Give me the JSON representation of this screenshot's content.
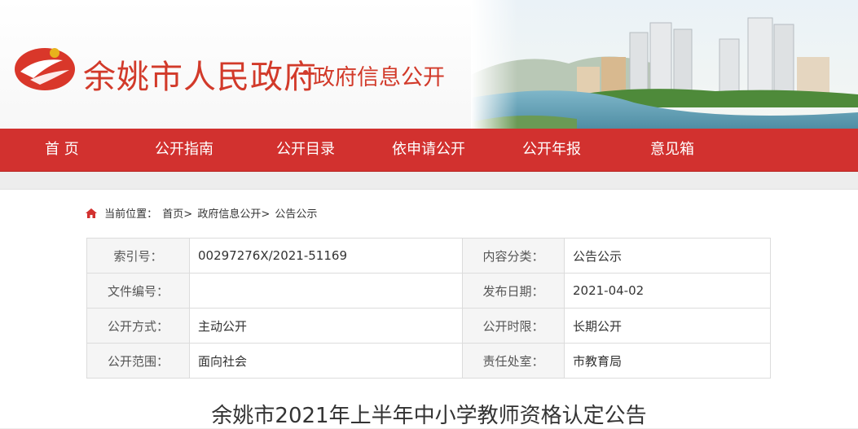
{
  "header": {
    "site_name": "余姚市人民政府",
    "site_sub": "政府信息公开"
  },
  "nav": [
    {
      "label": "首 页"
    },
    {
      "label": "公开指南"
    },
    {
      "label": "公开目录"
    },
    {
      "label": "依申请公开"
    },
    {
      "label": "公开年报"
    },
    {
      "label": "意见箱"
    }
  ],
  "breadcrumb": {
    "prefix": "当前位置：",
    "items": [
      "首页>",
      "政府信息公开>",
      "公告公示"
    ]
  },
  "meta": {
    "rows": [
      [
        {
          "k": "索引号：",
          "v": "00297276X/2021-51169"
        },
        {
          "k": "内容分类：",
          "v": "公告公示"
        }
      ],
      [
        {
          "k": "文件编号：",
          "v": ""
        },
        {
          "k": "发布日期：",
          "v": "2021-04-02"
        }
      ],
      [
        {
          "k": "公开方式：",
          "v": "主动公开"
        },
        {
          "k": "公开时限：",
          "v": "长期公开"
        }
      ],
      [
        {
          "k": "公开范围：",
          "v": "面向社会"
        },
        {
          "k": "责任处室：",
          "v": "市教育局"
        }
      ]
    ]
  },
  "article": {
    "title": "余姚市2021年上半年中小学教师资格认定公告"
  },
  "colors": {
    "brand_red": "#d2312f",
    "title_red": "#d23a2a"
  }
}
